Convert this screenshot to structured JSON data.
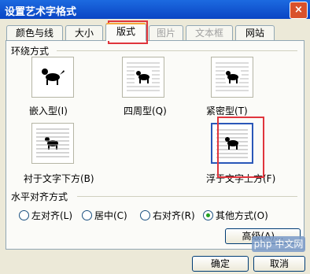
{
  "window": {
    "title": "设置艺术字格式",
    "close_symbol": "×"
  },
  "tabs": [
    {
      "label": "颜色与线条",
      "state": "normal"
    },
    {
      "label": "大小",
      "state": "normal"
    },
    {
      "label": "版式",
      "state": "active"
    },
    {
      "label": "图片",
      "state": "disabled"
    },
    {
      "label": "文本框",
      "state": "disabled"
    },
    {
      "label": "网站",
      "state": "normal"
    }
  ],
  "wrapping": {
    "group_title": "环绕方式",
    "styles": [
      {
        "label": "嵌入型(I)",
        "icon": "inline-dog-icon",
        "selected": false
      },
      {
        "label": "四周型(Q)",
        "icon": "square-dog-icon",
        "selected": false
      },
      {
        "label": "紧密型(T)",
        "icon": "tight-dog-icon",
        "selected": false
      },
      {
        "label": "衬于文字下方(B)",
        "icon": "behind-text-dog-icon",
        "selected": false
      },
      {
        "label": "浮于文字上方(F)",
        "icon": "in-front-dog-icon",
        "selected": true
      }
    ]
  },
  "alignment": {
    "group_title": "水平对齐方式",
    "options": [
      {
        "label": "左对齐(L)",
        "checked": false
      },
      {
        "label": "居中(C)",
        "checked": false
      },
      {
        "label": "右对齐(R)",
        "checked": false
      },
      {
        "label": "其他方式(O)",
        "checked": true
      }
    ]
  },
  "buttons": {
    "advanced": "高级(A)...",
    "ok": "确定",
    "cancel": "取消"
  },
  "watermark": "php 中文网",
  "colors": {
    "title_bar": "#0a45c4",
    "highlight": "#e0353d",
    "selected_border": "#2a57b8",
    "radio_checked": "#21a121"
  }
}
